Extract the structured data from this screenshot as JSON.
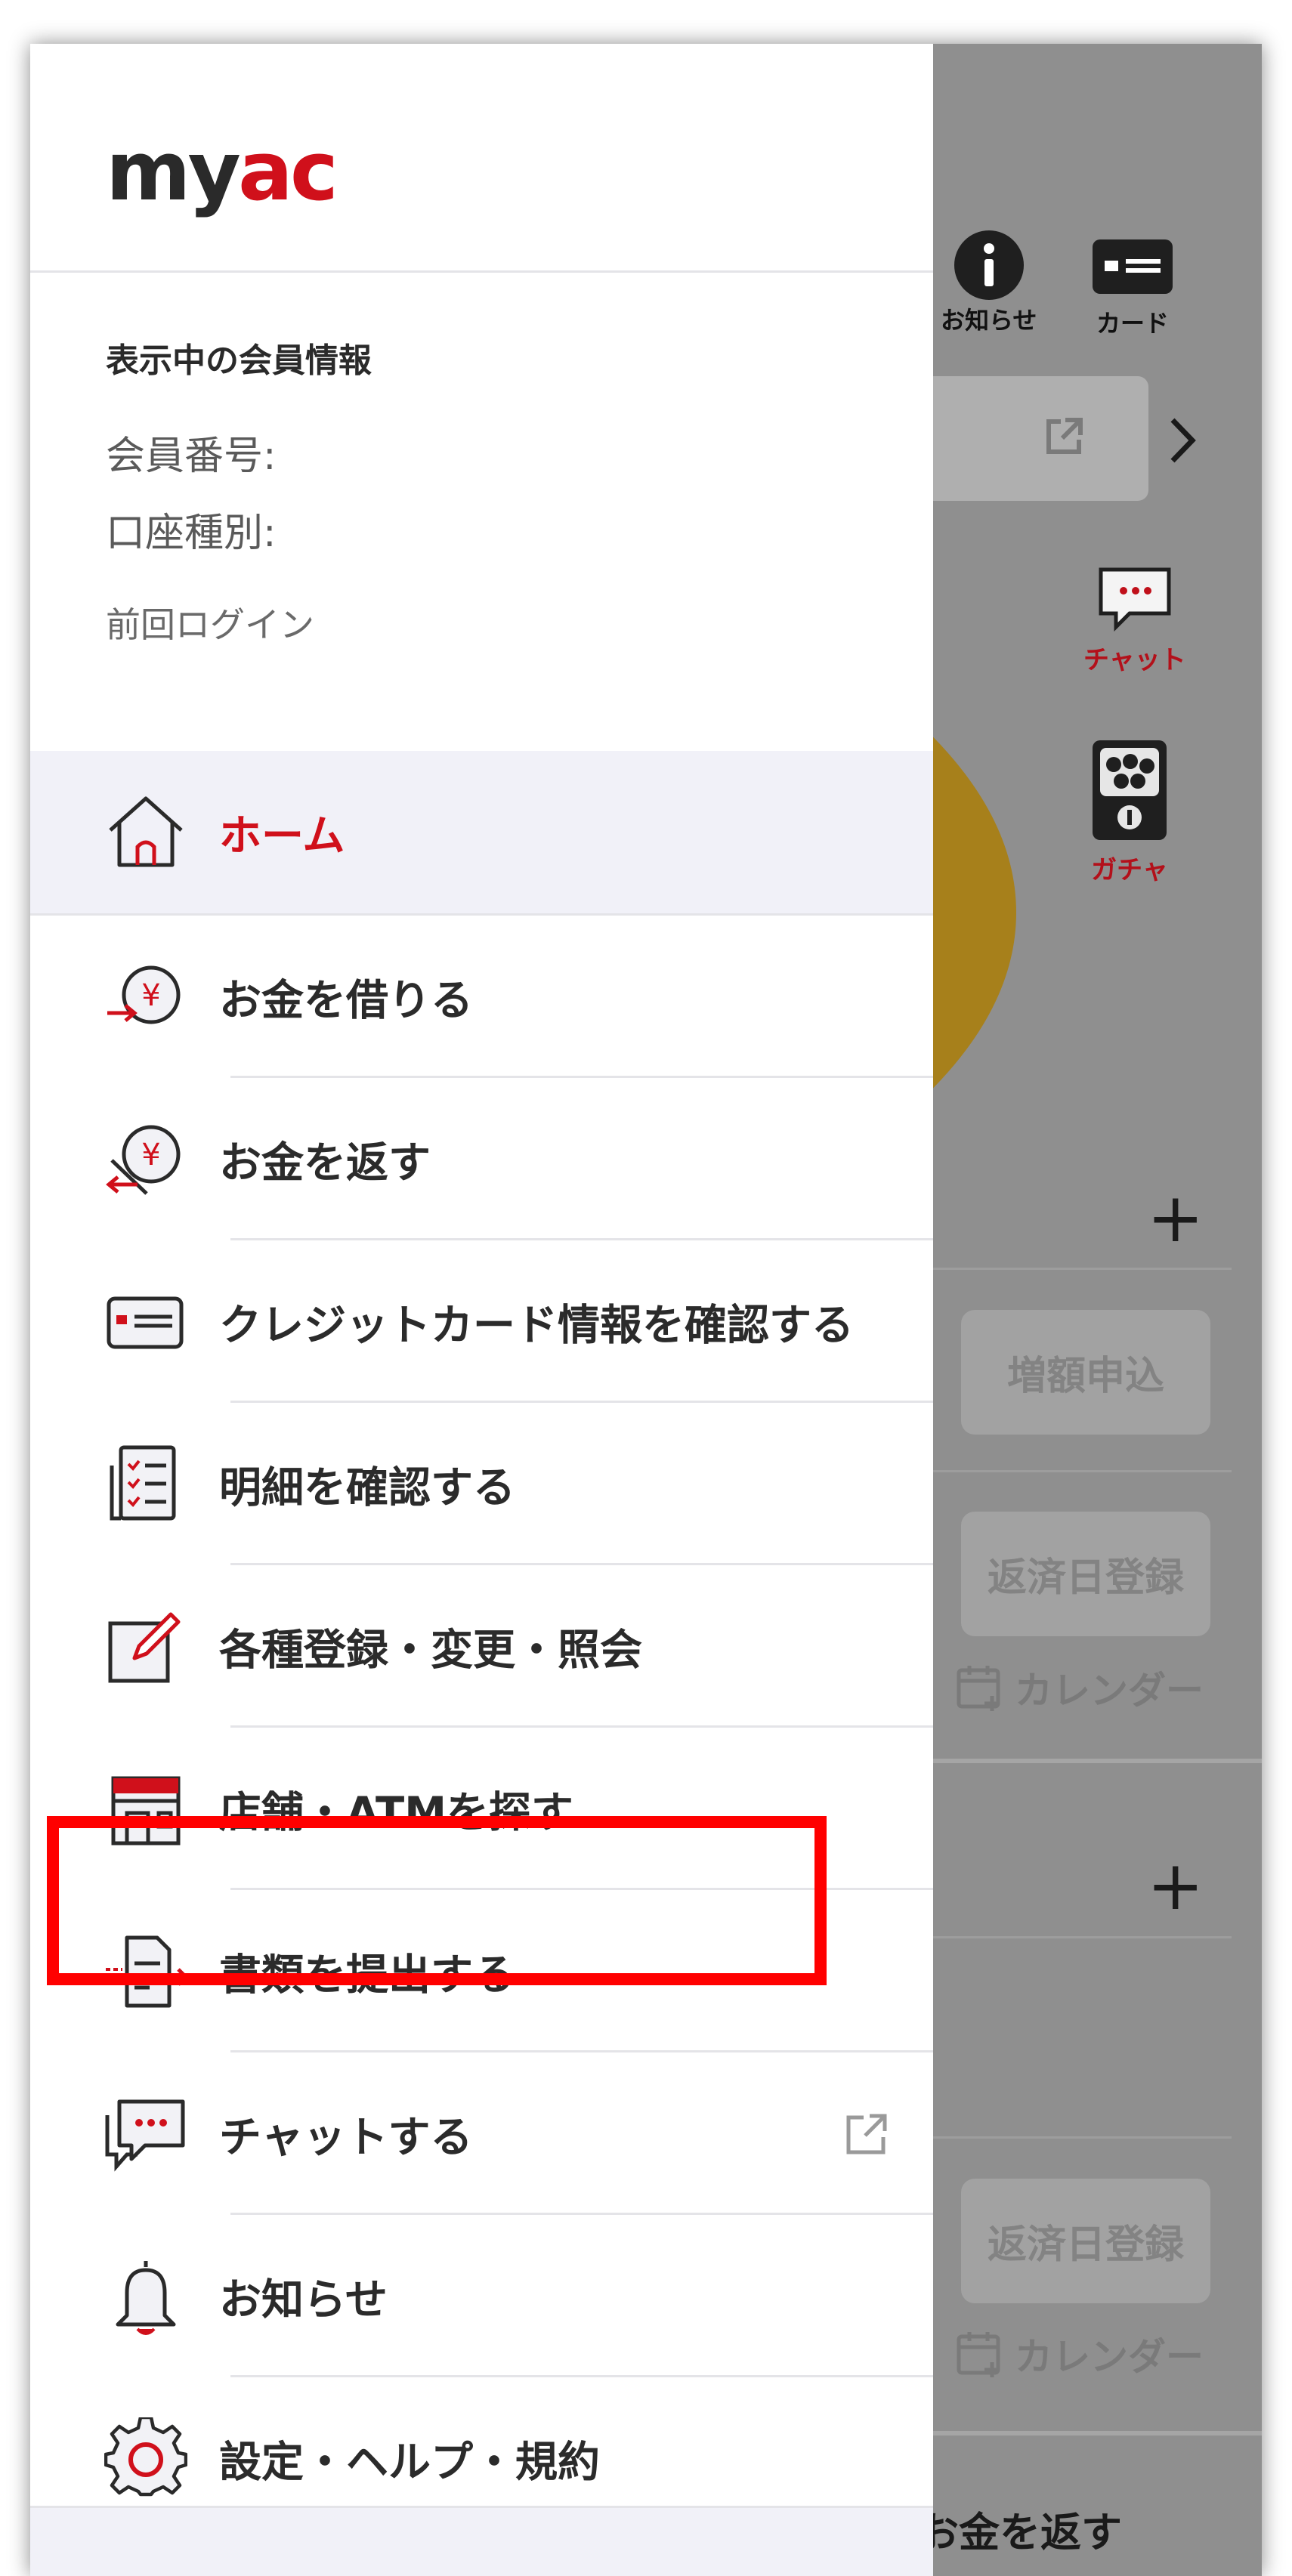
{
  "brand": {
    "logo_dark": "my",
    "logo_red": "ac",
    "dark_color": "#2a2a2a",
    "red_color": "#d0101b"
  },
  "member": {
    "title": "表示中の会員情報",
    "member_no_label": "会員番号:",
    "account_type_label": "口座種別:",
    "last_login_label": "前回ログイン"
  },
  "menu": [
    {
      "label": "ホーム",
      "icon": "home-icon",
      "active": true
    },
    {
      "label": "お金を借りる",
      "icon": "borrow-yen-icon"
    },
    {
      "label": "お金を返す",
      "icon": "repay-yen-icon"
    },
    {
      "label": "クレジットカード情報を確認する",
      "icon": "credit-card-icon"
    },
    {
      "label": "明細を確認する",
      "icon": "statement-icon"
    },
    {
      "label": "各種登録・変更・照会",
      "icon": "edit-icon"
    },
    {
      "label": "店舗・ATMを探す",
      "icon": "store-icon"
    },
    {
      "label": "書類を提出する",
      "icon": "submit-document-icon",
      "highlighted": true
    },
    {
      "label": "チャットする",
      "icon": "chat-icon",
      "external": true
    },
    {
      "label": "お知らせ",
      "icon": "bell-icon"
    },
    {
      "label": "設定・ヘルプ・規約",
      "icon": "settings-gear-icon"
    }
  ],
  "background": {
    "notice_label": "お知らせ",
    "card_label": "カード",
    "chat_label": "チャット",
    "gacha_label": "ガチャ",
    "increase_button": "増額申込",
    "repay_date_button_1": "返済日登録",
    "calendar_label_1": "カレンダー",
    "repay_date_button_2": "返済日登録",
    "calendar_label_2": "カレンダー",
    "bottom_text": "お金を返す"
  }
}
